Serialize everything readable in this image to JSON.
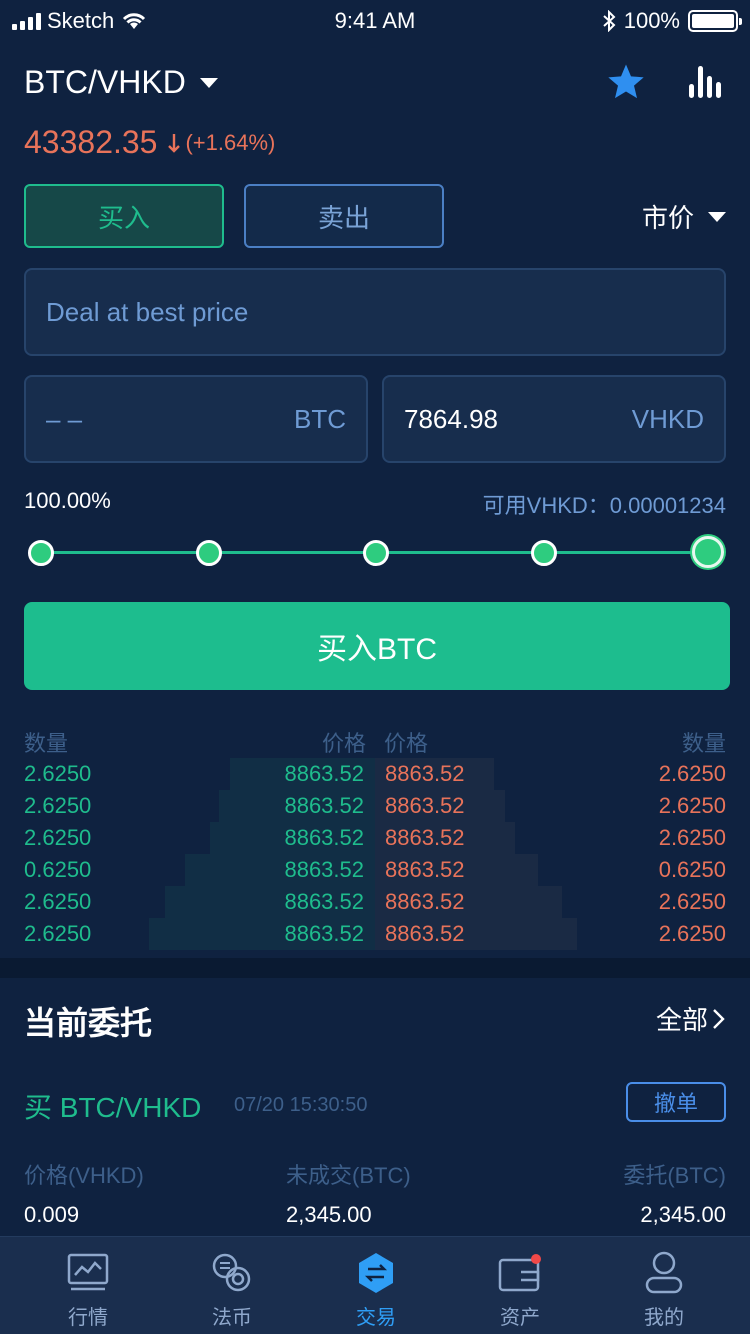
{
  "status_bar": {
    "carrier": "Sketch",
    "time": "9:41 AM",
    "battery": "100%"
  },
  "header": {
    "pair": "BTC/VHKD",
    "price": "43382.35",
    "change": "(+1.64%)"
  },
  "tabs": {
    "buy": "买入",
    "sell": "卖出",
    "order_type": "市价"
  },
  "form": {
    "best_price_placeholder": "Deal at best price",
    "amount_placeholder": "– –",
    "amount_unit": "BTC",
    "total_value": "7864.98",
    "total_unit": "VHKD",
    "percent": "100.00%",
    "available": "可用VHKD：0.00001234",
    "slider_level": 1.0,
    "buy_button": "买入BTC"
  },
  "order_book": {
    "headers": {
      "bid_qty": "数量",
      "bid_price": "价格",
      "ask_price": "价格",
      "ask_qty": "数量"
    },
    "rows": [
      {
        "bid_qty": "2.6250",
        "bid_price": "8863.52",
        "ask_price": "8863.52",
        "ask_qty": "2.6250",
        "bid_depth": 0.64,
        "ask_depth": 0.58
      },
      {
        "bid_qty": "2.6250",
        "bid_price": "8863.52",
        "ask_price": "8863.52",
        "ask_qty": "2.6250",
        "bid_depth": 0.69,
        "ask_depth": 0.63
      },
      {
        "bid_qty": "2.6250",
        "bid_price": "8863.52",
        "ask_price": "8863.52",
        "ask_qty": "2.6250",
        "bid_depth": 0.73,
        "ask_depth": 0.68
      },
      {
        "bid_qty": "0.6250",
        "bid_price": "8863.52",
        "ask_price": "8863.52",
        "ask_qty": "0.6250",
        "bid_depth": 0.84,
        "ask_depth": 0.79
      },
      {
        "bid_qty": "2.6250",
        "bid_price": "8863.52",
        "ask_price": "8863.52",
        "ask_qty": "2.6250",
        "bid_depth": 0.93,
        "ask_depth": 0.91
      },
      {
        "bid_qty": "2.6250",
        "bid_price": "8863.52",
        "ask_price": "8863.52",
        "ask_qty": "2.6250",
        "bid_depth": 1.0,
        "ask_depth": 0.98
      }
    ]
  },
  "orders": {
    "title": "当前委托",
    "all_link": "全部",
    "pair": "买 BTC/VHKD",
    "time": "07/20 15:30:50",
    "cancel": "撤单",
    "labels": {
      "price": "价格(VHKD)",
      "unfilled": "未成交(BTC)",
      "total": "委托(BTC)"
    },
    "values": {
      "price": "0.009",
      "unfilled": "2,345.00",
      "total": "2,345.00"
    }
  },
  "tabbar": {
    "items": [
      {
        "label": "行情",
        "icon": "chart-monitor-icon"
      },
      {
        "label": "法币",
        "icon": "currency-exchange-icon"
      },
      {
        "label": "交易",
        "icon": "trade-hexagon-icon"
      },
      {
        "label": "资产",
        "icon": "wallet-icon"
      },
      {
        "label": "我的",
        "icon": "profile-icon"
      }
    ],
    "active_index": 2
  },
  "colors": {
    "accent_green": "#1fbc8d",
    "accent_red": "#e8735a",
    "accent_blue": "#2f9ef5",
    "background": "#0f2240"
  }
}
